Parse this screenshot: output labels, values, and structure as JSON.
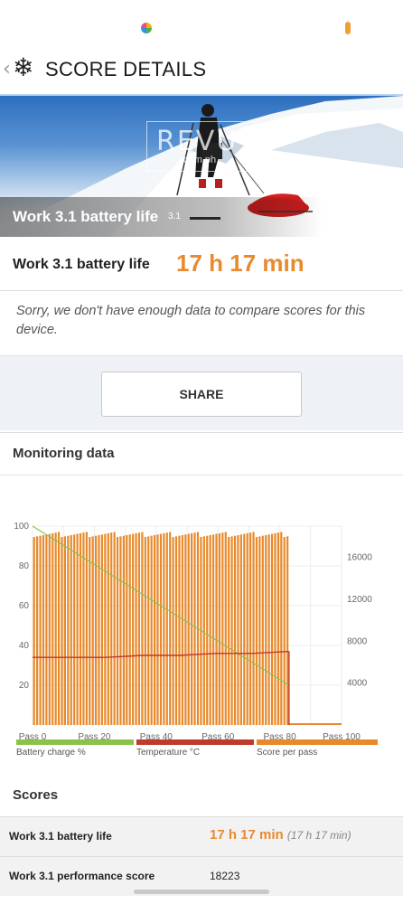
{
  "header": {
    "back_icon": "chevron-left-icon",
    "app_icon": "snowflake-icon",
    "title": "SCORE DETAILS"
  },
  "hero": {
    "caption": "Work 3.1 battery life",
    "version": "3.1",
    "watermark_main": "REVU",
    "watermark_sub": "com.ph"
  },
  "result": {
    "label": "Work 3.1 battery life",
    "value": "17 h 17 min"
  },
  "notice": "Sorry, we don't have enough data to compare scores for this device.",
  "share_label": "SHARE",
  "monitoring": {
    "title": "Monitoring data",
    "legend": [
      {
        "label": "Battery charge %",
        "color": "#8bc34a"
      },
      {
        "label": "Temperature °C",
        "color": "#c0392b"
      },
      {
        "label": "Score per pass",
        "color": "#e8892b"
      }
    ]
  },
  "chart_data": {
    "type": "bar",
    "x_ticks": [
      "Pass 0",
      "Pass 20",
      "Pass 40",
      "Pass 60",
      "Pass 80",
      "Pass 100"
    ],
    "x_range": [
      0,
      100
    ],
    "y_left_ticks": [
      "20",
      "40",
      "60",
      "80",
      "100"
    ],
    "y_left_range": [
      0,
      100
    ],
    "y_right_ticks": [
      "4000",
      "8000",
      "12000",
      "16000"
    ],
    "y_right_range": [
      0,
      19000
    ],
    "grid": true,
    "series": [
      {
        "name": "Score per pass",
        "axis": "right",
        "color": "#e8892b",
        "passes": 83,
        "values_approx": 18200
      },
      {
        "name": "Battery charge %",
        "axis": "left",
        "color": "#8bc34a",
        "start": 100,
        "end": 20
      },
      {
        "name": "Temperature °C",
        "axis": "left",
        "color": "#c0392b",
        "values": [
          34,
          34,
          34,
          35,
          35,
          36,
          36,
          37
        ]
      }
    ]
  },
  "scores": {
    "title": "Scores",
    "rows": [
      {
        "name": "Work 3.1 battery life",
        "value": "17 h 17 min",
        "sub": "(17 h 17 min)"
      },
      {
        "name": "Work 3.1 performance score",
        "value": "18223"
      }
    ]
  }
}
